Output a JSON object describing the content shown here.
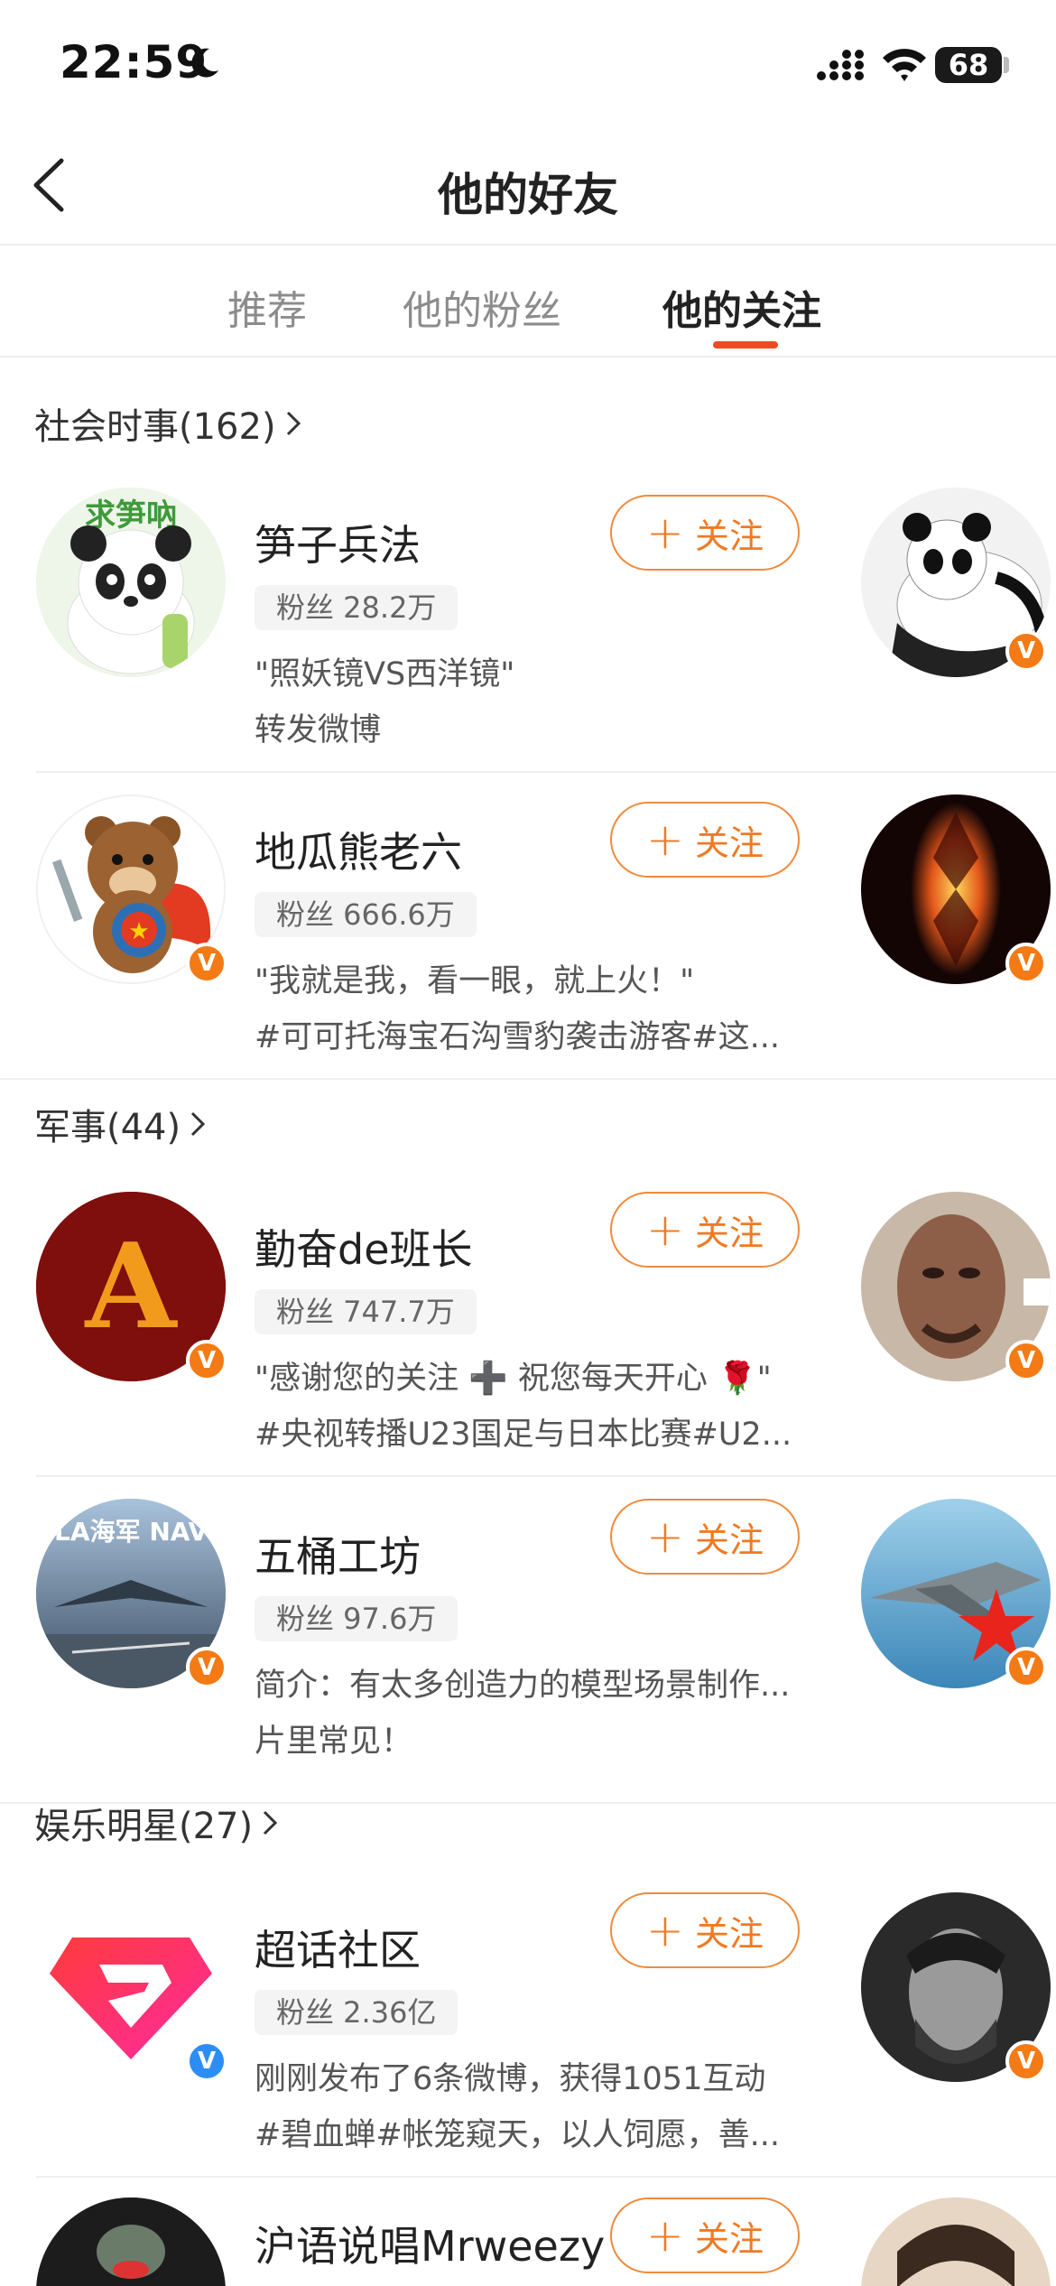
{
  "status_bar": {
    "time": "22:59",
    "battery": "68"
  },
  "nav": {
    "title": "他的好友"
  },
  "tabs": [
    {
      "label": "推荐",
      "active": false
    },
    {
      "label": "他的粉丝",
      "active": false
    },
    {
      "label": "他的关注",
      "active": true
    }
  ],
  "sections": [
    {
      "title": "社会时事(162)"
    },
    {
      "title": "军事(44)"
    },
    {
      "title": "娱乐明星(27)"
    }
  ],
  "follow_label": "关注",
  "users": [
    {
      "name": "笋子兵法",
      "fans": "粉丝 28.2万",
      "line1": "\"照妖镜VS西洋镜\"",
      "line2": "转发微博",
      "verified": false
    },
    {
      "name": "地瓜熊老六",
      "fans": "粉丝 666.6万",
      "line1": "\"我就是我，看一眼，就上火！\"",
      "line2": "#可可托海宝石沟雪豹袭击游客#这...",
      "verified": true,
      "verify_color": "orange"
    },
    {
      "name": "勤奋de班长",
      "fans": "粉丝 747.7万",
      "line1": "\"感谢您的关注 ➕ 祝您每天开心 🌹\"",
      "line2": "#央视转播U23国足与日本比赛#U2...",
      "verified": true,
      "verify_color": "orange"
    },
    {
      "name": "五桶工坊",
      "fans": "粉丝 97.6万",
      "line1": "简介：有太多创造力的模型场景制作...",
      "line2": "片里常见！",
      "verified": true,
      "verify_color": "orange"
    },
    {
      "name": "超话社区",
      "fans": "粉丝 2.36亿",
      "line1": "刚刚发布了6条微博，获得1051互动",
      "line2": "#碧血蝉#帐笼窥天，以人饲愿，善...",
      "verified": true,
      "verify_color": "blue"
    },
    {
      "name": "沪语说唱Mrweezy"
    }
  ],
  "avatar_text": {
    "a_letter": "A",
    "navy_label": "PLA海军 NAVY",
    "bamboo_label": "求笋吶"
  }
}
